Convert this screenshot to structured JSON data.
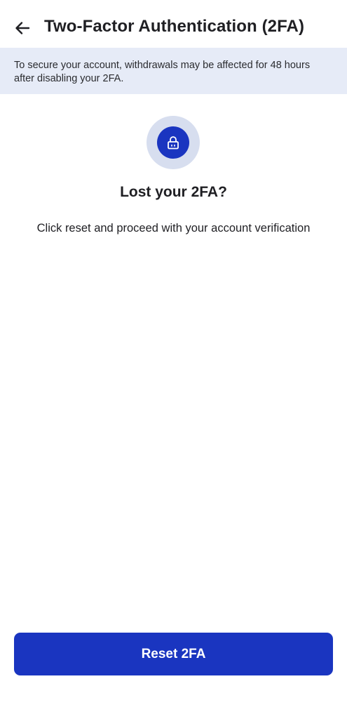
{
  "header": {
    "back_icon": "arrow-left-icon",
    "title": "Two-Factor Authentication (2FA)"
  },
  "notice": {
    "text": "To secure your account, withdrawals may be affected for 48 hours after disabling your 2FA."
  },
  "main": {
    "icon": "lock-icon",
    "headline": "Lost your 2FA?",
    "description": "Click reset and proceed with your account verification"
  },
  "footer": {
    "reset_label": "Reset 2FA"
  },
  "colors": {
    "accent": "#1a35c0",
    "notice_bg": "#e6ebf7",
    "icon_ring": "#d7deef",
    "text": "#1f1f23"
  }
}
